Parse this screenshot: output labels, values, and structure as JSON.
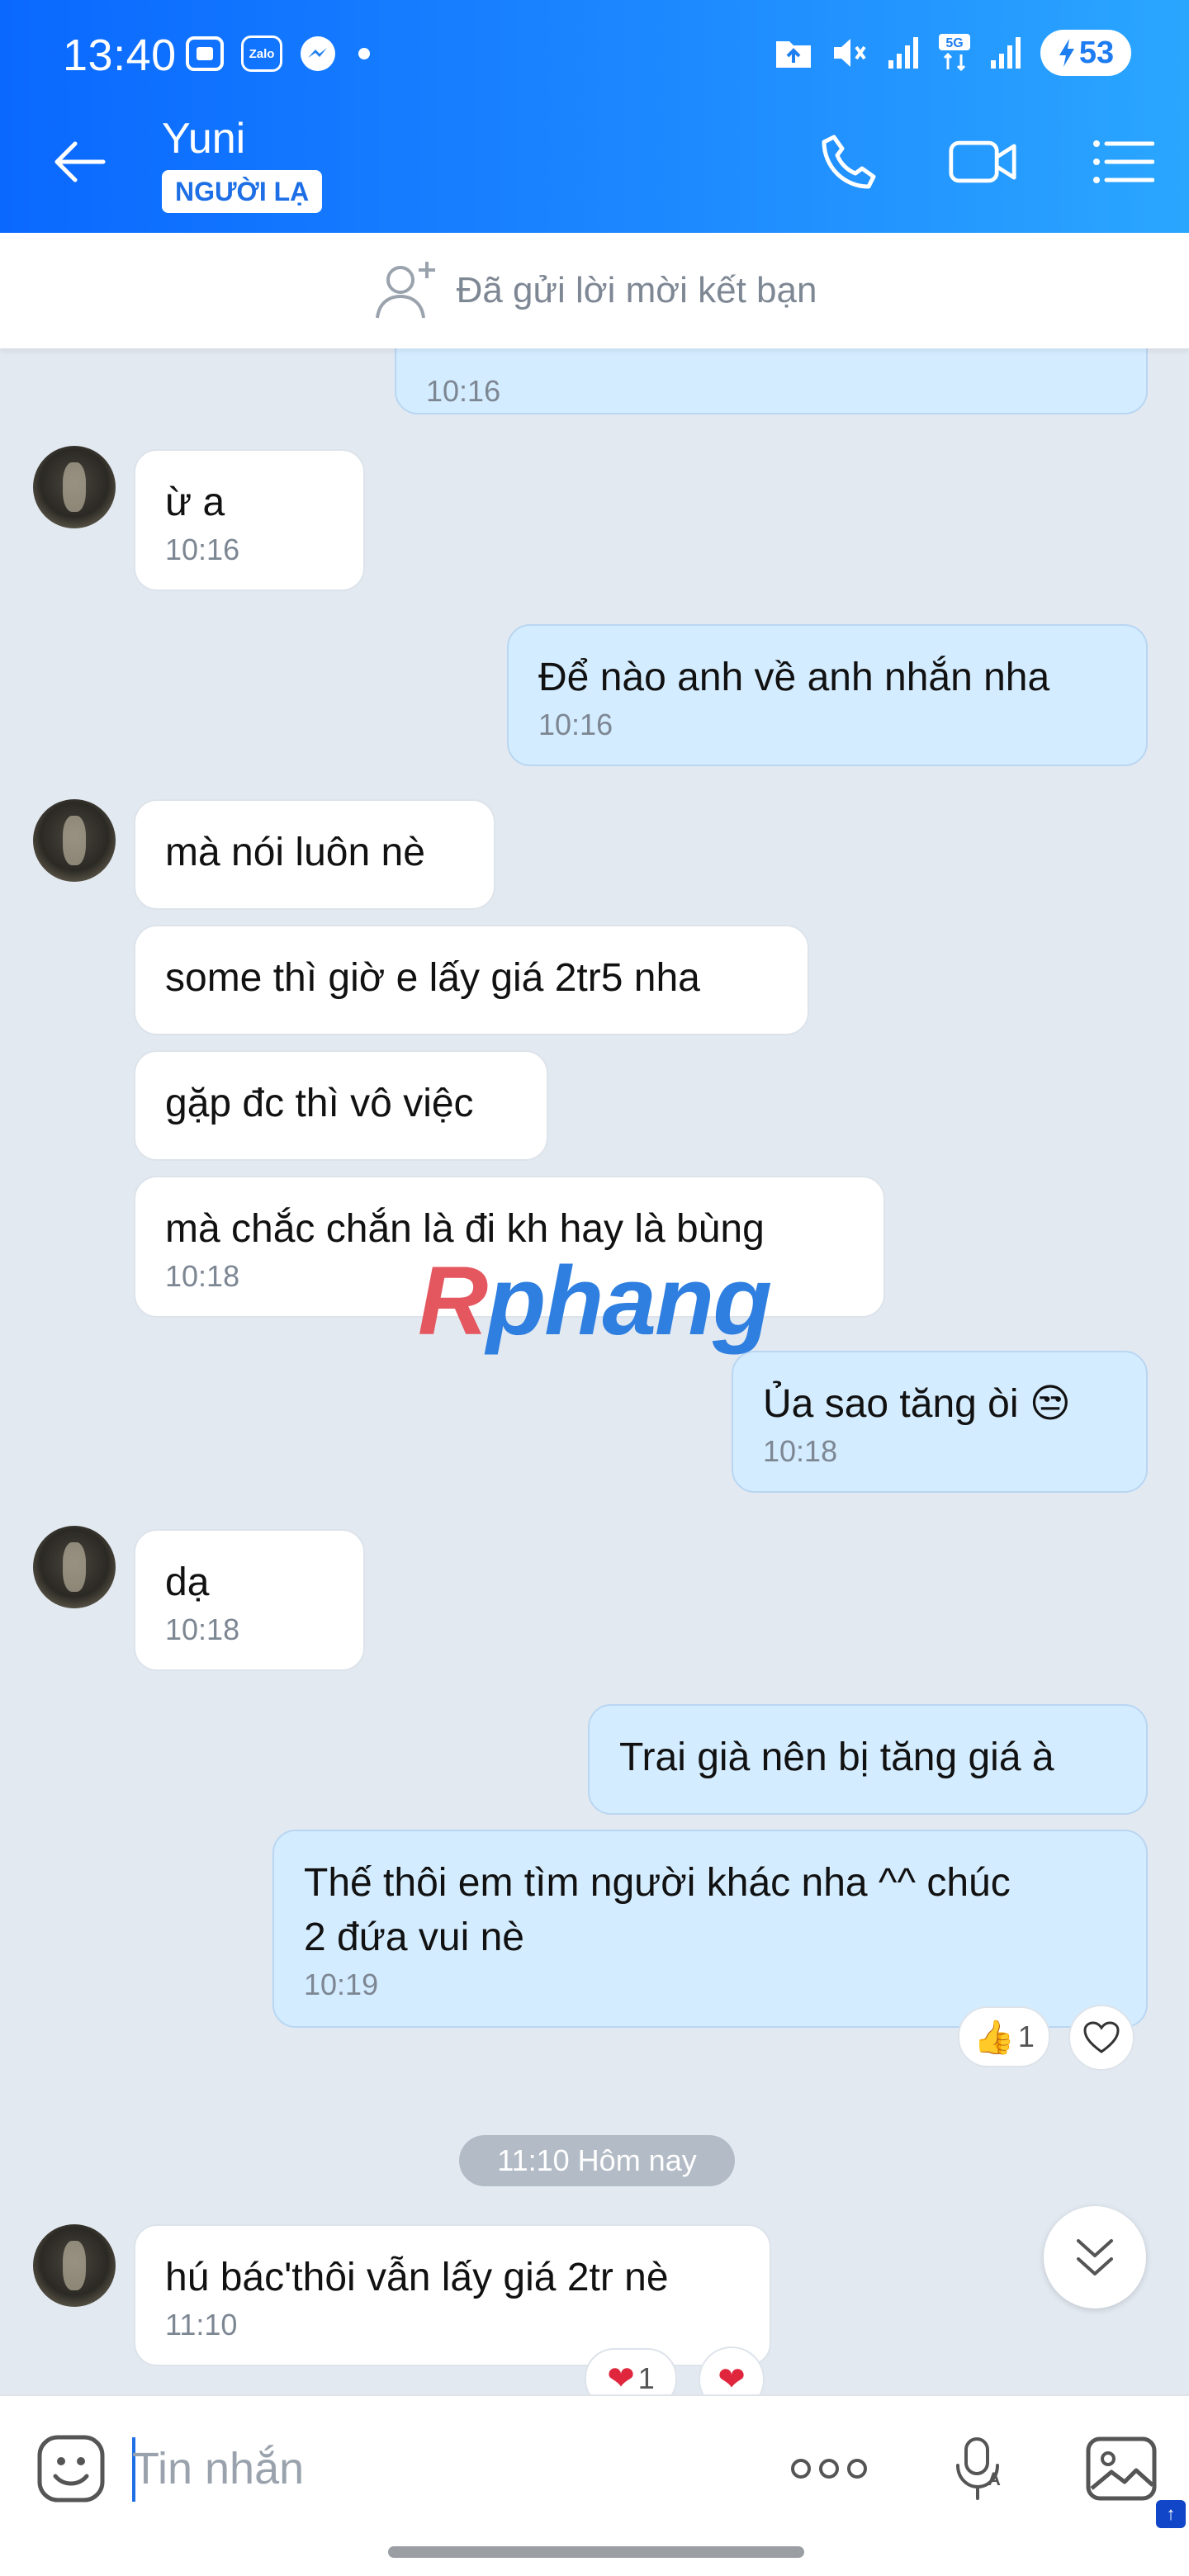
{
  "status_bar": {
    "time": "13:40",
    "zalo_label": "Zalo",
    "battery": "53",
    "network": "5G"
  },
  "header": {
    "contact_name": "Yuni",
    "badge": "NGƯỜI LẠ"
  },
  "friend_bar": {
    "text": "Đã gửi lời mời kết bạn"
  },
  "messages": [
    {
      "dir": "out",
      "text": "",
      "time": "10:16"
    },
    {
      "dir": "in",
      "text": "ừ a",
      "time": "10:16"
    },
    {
      "dir": "out",
      "text": "Để nào anh về anh nhắn nha",
      "time": "10:16"
    },
    {
      "dir": "in",
      "text": "mà nói luôn nè",
      "time": ""
    },
    {
      "dir": "in",
      "text": "some thì giờ e lấy giá 2tr5 nha",
      "time": ""
    },
    {
      "dir": "in",
      "text": "gặp đc thì vô việc",
      "time": ""
    },
    {
      "dir": "in",
      "text": "mà chắc chắn là đi kh hay là bùng",
      "time": "10:18"
    },
    {
      "dir": "out",
      "text": "Ủa sao tăng òi",
      "emoji": "😒",
      "time": "10:18"
    },
    {
      "dir": "in",
      "text": "dạ",
      "time": "10:18"
    },
    {
      "dir": "out",
      "text": "Trai già nên bị tăng giá à",
      "time": ""
    },
    {
      "dir": "out",
      "text_line1": "Thế thôi em tìm người khác nha ^^ chúc",
      "text_line2": "2 đứa vui nè",
      "time": "10:19"
    },
    {
      "dir": "in",
      "text": "hú bác'thôi vẫn lấy giá 2tr nè",
      "time": "11:10"
    }
  ],
  "reactions": {
    "msg10_like_count": "1",
    "msg11_heart_count": "1"
  },
  "date_divider": "11:10 Hôm nay",
  "watermark": {
    "first": "R",
    "rest": "phang"
  },
  "composer": {
    "placeholder": "Tin nhắn"
  },
  "colors": {
    "header_start": "#0a68ff",
    "header_end": "#2aa6ff",
    "outgoing_bubble": "#d4ecff",
    "incoming_bubble": "#ffffff",
    "background": "#e2e9f1"
  }
}
